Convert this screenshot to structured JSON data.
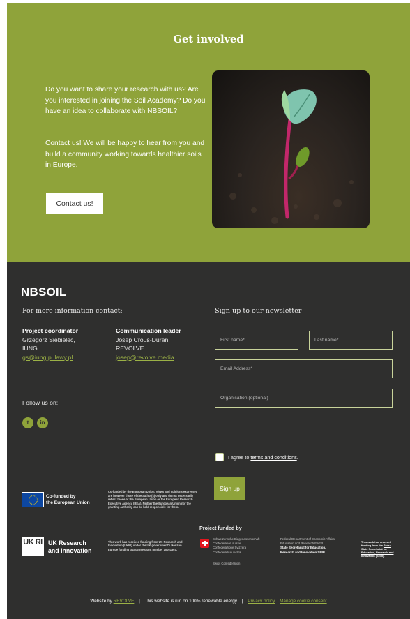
{
  "hero": {
    "title": "Get involved",
    "paragraph1": "Do you want to share your research with us? Are you interested in joining the Soil Academy? Do you have an idea to collaborate with NBSOIL?",
    "paragraph2": "Contact us! We will be happy to hear from you and build a community working towards healthier soils in Europe.",
    "contact_button": "Contact us!",
    "background_color": "#8fa33a",
    "image_icon": "seedling-photo"
  },
  "footer": {
    "background_color": "#2f2f2e",
    "accent_color": "#8fa33a",
    "brand": "NBSOIL",
    "more_info": "For more information contact:",
    "contacts": [
      {
        "role": "Project coordinator",
        "name": "Grzegorz Siebielec,",
        "org": "IUNG",
        "email": "gs@iung.pulawy.pl"
      },
      {
        "role": "Communication leader",
        "name": "Josep Crous-Duran,",
        "org": "REVOLVE",
        "email": "josep@revolve.media"
      }
    ],
    "follow_us": "Follow us on:",
    "social": [
      {
        "icon": "twitter-icon",
        "glyph": "t"
      },
      {
        "icon": "linkedin-icon",
        "glyph": "in"
      }
    ]
  },
  "newsletter": {
    "title": "Sign up to our newsletter",
    "first_name_placeholder": "First name*",
    "last_name_placeholder": "Last name*",
    "email_placeholder": "Email Address*",
    "organisation_placeholder": "Organisation (optional)",
    "agree_prefix": "I agree to ",
    "terms_link": "terms and conditions",
    "agree_suffix": ".",
    "signup_button": "Sign up"
  },
  "funding": {
    "eu_label_line1": "Co-funded by",
    "eu_label_line2": "the European Union",
    "eu_disclaimer": "Co-funded by the European Union. Views and opinions expressed are however those of the author(s) only and do not necessarily reflect those of the European Union or the European Research Executive Agency (REA). Neither the European Union nor the granting authority can be held responsible for them.",
    "project_funded_by": "Project funded by",
    "ukri_logo_text": "UK RI",
    "ukri_line1": "UK Research",
    "ukri_line2": "and Innovation",
    "ukri_disclaimer": "This work has received funding from UK Research and Innovation (UKRI) under the UK government's Horizon Europe funding guarantee grant number 10051667.",
    "swiss_names": [
      "Schweizerische Eidgenossenschaft",
      "Confédération suisse",
      "Confederazione Svizzera",
      "Confederaziun svizra"
    ],
    "swiss_confederation": "Swiss Confederation",
    "swiss_dept_line1": "Federal Department of Economic Affairs,",
    "swiss_dept_line2": "Education and Research EAER",
    "swiss_sec_line1": "State Secretariat for Education,",
    "swiss_sec_line2": "Research and Innovation SERI",
    "swiss_disclaimer_prefix": "This work has received funding from the ",
    "swiss_disclaimer_link": "Swiss State Secretariat for Education, Research and Innovation (SERI)",
    "swiss_disclaimer_suffix": "."
  },
  "bottom": {
    "website_by": "Website by ",
    "revolve_link": "REVOLVE",
    "sep": "|",
    "renewable": "This website is run on 100% renewable energy",
    "privacy": "Privacy policy",
    "cookies": "Manage cookie consent"
  }
}
